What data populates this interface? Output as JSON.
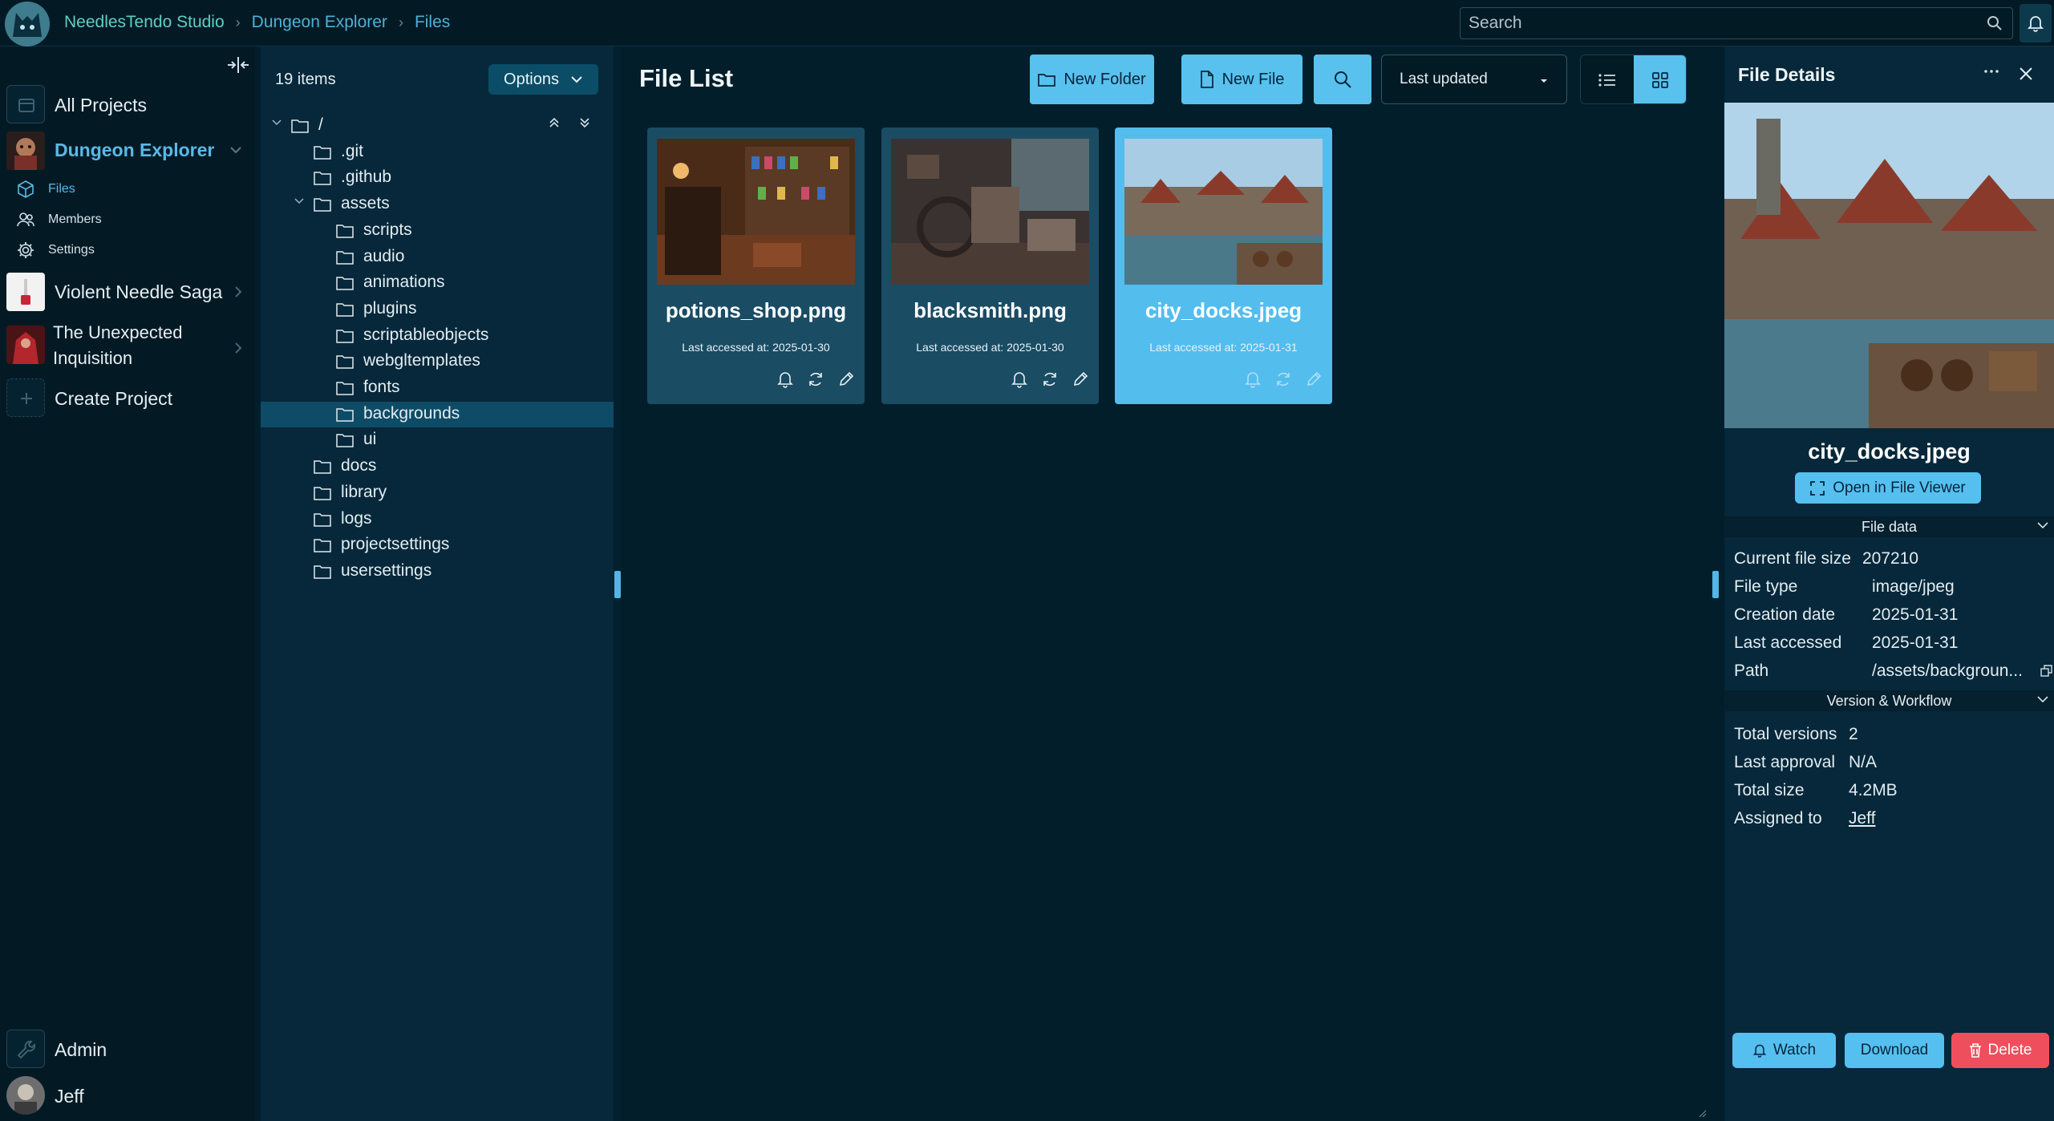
{
  "topbar": {
    "org": "NeedlesTendo Studio",
    "crumb_project": "Dungeon Explorer",
    "crumb_current": "Files",
    "search_placeholder": "Search"
  },
  "sidebar": {
    "all_projects": "All Projects",
    "active_project": "Dungeon Explorer",
    "sub_files": "Files",
    "sub_members": "Members",
    "sub_settings": "Settings",
    "project2": "Violent Needle Saga",
    "project3_line1": "The Unexpected",
    "project3_line2": "Inquisition",
    "create_project": "Create Project",
    "admin": "Admin",
    "user": "Jeff"
  },
  "tree": {
    "count": "19 items",
    "options_label": "Options",
    "rows": [
      {
        "label": "/"
      },
      {
        "label": ".git"
      },
      {
        "label": ".github"
      },
      {
        "label": "assets"
      },
      {
        "label": "scripts"
      },
      {
        "label": "audio"
      },
      {
        "label": "animations"
      },
      {
        "label": "plugins"
      },
      {
        "label": "scriptableobjects"
      },
      {
        "label": "webgltemplates"
      },
      {
        "label": "fonts"
      },
      {
        "label": "backgrounds"
      },
      {
        "label": "ui"
      },
      {
        "label": "docs"
      },
      {
        "label": "library"
      },
      {
        "label": "logs"
      },
      {
        "label": "projectsettings"
      },
      {
        "label": "usersettings"
      }
    ]
  },
  "file_list": {
    "title": "File List",
    "new_folder": "New Folder",
    "new_file": "New File",
    "sort_selected": "Last updated",
    "cards": [
      {
        "name": "potions_shop.png",
        "accessed": "Last accessed at: 2025-01-30"
      },
      {
        "name": "blacksmith.png",
        "accessed": "Last accessed at: 2025-01-30"
      },
      {
        "name": "city_docks.jpeg",
        "accessed": "Last accessed at: 2025-01-31"
      }
    ]
  },
  "details": {
    "title": "File Details",
    "file_name": "city_docks.jpeg",
    "open_viewer": "Open in File Viewer",
    "file_data_header": "File data",
    "current_size_label": "Current file size",
    "current_size": "207210",
    "file_type_label": "File type",
    "file_type": "image/jpeg",
    "creation_label": "Creation date",
    "creation": "2025-01-31",
    "last_accessed_label": "Last accessed",
    "last_accessed": "2025-01-31",
    "path_label": "Path",
    "path": "/assets/backgroun...",
    "version_header": "Version & Workflow",
    "total_versions_label": "Total versions",
    "total_versions": "2",
    "last_approval_label": "Last approval",
    "last_approval": "N/A",
    "total_size_label": "Total size",
    "total_size": "4.2MB",
    "assigned_label": "Assigned to",
    "assigned": "Jeff",
    "watch": "Watch",
    "download": "Download",
    "delete": "Delete"
  }
}
